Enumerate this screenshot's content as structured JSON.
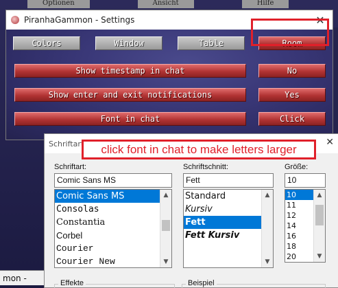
{
  "background": {
    "menu": [
      "Optionen",
      "Ansicht",
      "Hilfe"
    ],
    "footer_text": "mon - Online"
  },
  "settings": {
    "title": "PiranhaGammon - Settings",
    "close": "✕",
    "tabs": [
      "Colors",
      "Window",
      "Table",
      "Room"
    ],
    "rows": [
      {
        "label": "Show timestamp in chat",
        "value": "No"
      },
      {
        "label": "Show enter and exit notifications",
        "value": "Yes"
      },
      {
        "label": "Font in chat",
        "value": "Click"
      }
    ]
  },
  "font_dialog": {
    "title": "Schriftart",
    "close": "✕",
    "annotation": "click font in chat to make letters larger",
    "font_label": "Schriftart:",
    "font_value": "Comic Sans MS",
    "fonts": [
      "Comic Sans MS",
      "Consolas",
      "Constantia",
      "Corbel",
      "Courier",
      "Courier New"
    ],
    "style_label": "Schriftschnitt:",
    "style_value": "Fett",
    "styles": [
      "Standard",
      "Kursiv",
      "Fett",
      "Fett Kursiv"
    ],
    "size_label": "Größe:",
    "size_value": "10",
    "sizes": [
      "10",
      "11",
      "12",
      "14",
      "16",
      "18",
      "20"
    ],
    "effects_label": "Effekte",
    "sample_label": "Beispiel"
  },
  "colors": {
    "annotation_red": "#e0202a",
    "selection_blue": "#0078d7",
    "button_red": "#b23434"
  }
}
